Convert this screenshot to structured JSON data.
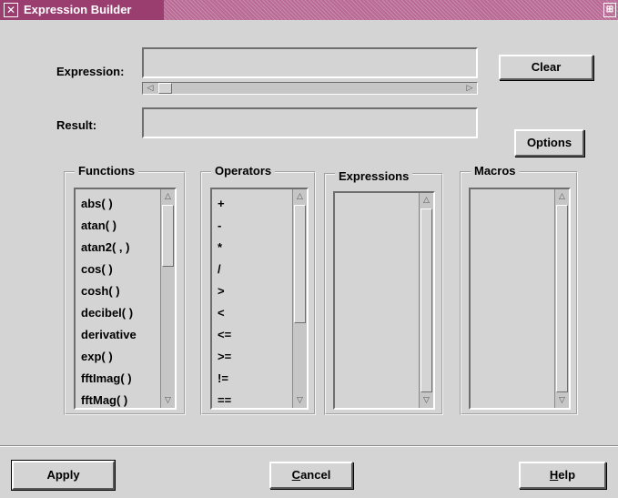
{
  "window": {
    "title": "Expression Builder",
    "icon": "x-window-icon",
    "control_icon": "window-menu-icon"
  },
  "expression": {
    "label": "Expression:",
    "value": "",
    "scroll_left_icon": "arrow-left-icon",
    "scroll_right_icon": "arrow-right-icon"
  },
  "result": {
    "label": "Result:",
    "value": ""
  },
  "buttons": {
    "clear": "Clear",
    "options": "Options",
    "apply": "Apply",
    "cancel_prefix": "C",
    "cancel_rest": "ancel",
    "help_prefix": "H",
    "help_rest": "elp"
  },
  "functions": {
    "title": "Functions",
    "items": [
      "abs( )",
      "atan( )",
      "atan2( , )",
      "cos( )",
      "cosh( )",
      "decibel( )",
      "derivative",
      "exp( )",
      "fftImag( )",
      "fftMag( )"
    ]
  },
  "operators": {
    "title": "Operators",
    "items": [
      "+",
      "-",
      "*",
      "/",
      ">",
      "<",
      "<=",
      ">=",
      "!=",
      "=="
    ]
  },
  "expressions": {
    "title": "Expressions",
    "items": []
  },
  "macros": {
    "title": "Macros",
    "items": []
  }
}
